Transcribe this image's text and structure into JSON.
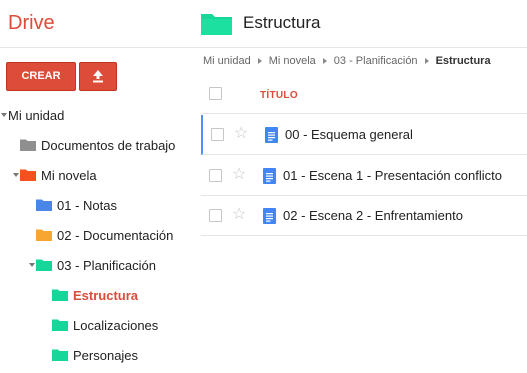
{
  "app": {
    "logo": "Drive"
  },
  "header": {
    "title": "Estructura"
  },
  "sidebar": {
    "create_label": "CREAR",
    "tree": [
      {
        "label": "Mi unidad",
        "folder": "none",
        "caret": "open"
      },
      {
        "label": "Documentos de trabajo",
        "folder": "gray",
        "caret": "none"
      },
      {
        "label": "Mi novela",
        "folder": "orange",
        "caret": "open"
      },
      {
        "label": "01 - Notas",
        "folder": "blue",
        "caret": "none"
      },
      {
        "label": "02 - Documentación",
        "folder": "yellow",
        "caret": "none"
      },
      {
        "label": "03 - Planificación",
        "folder": "green",
        "caret": "open"
      },
      {
        "label": "Estructura",
        "folder": "green",
        "caret": "none",
        "active": true
      },
      {
        "label": "Localizaciones",
        "folder": "green",
        "caret": "none"
      },
      {
        "label": "Personajes",
        "folder": "green",
        "caret": "none"
      }
    ]
  },
  "breadcrumb": [
    "Mi unidad",
    "Mi novela",
    "03 - Planificación",
    "Estructura"
  ],
  "list": {
    "column_title": "TÍTULO",
    "rows": [
      {
        "name": "00 - Esquema general"
      },
      {
        "name": "01 - Escena 1 - Presentación conflicto"
      },
      {
        "name": "02 - Escena 2 - Enfrentamiento"
      }
    ]
  },
  "colors": {
    "accent": "#dd4b39",
    "folder_gray": "#8f8f8f",
    "folder_orange": "#f4511e",
    "folder_blue": "#4986e7",
    "folder_yellow": "#f7a731",
    "folder_green": "#16d799",
    "doc_blue": "#4285f4",
    "focus_blue": "#4d90fe"
  }
}
